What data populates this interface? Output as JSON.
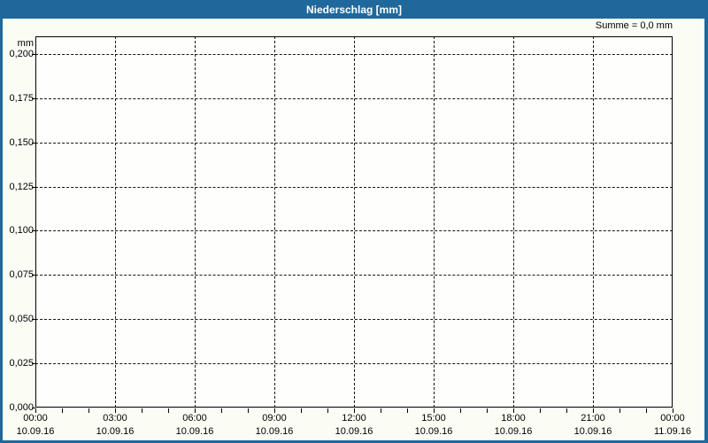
{
  "window": {
    "title": "Niederschlag [mm]"
  },
  "colors": {
    "titlebar_background": "#1e689c",
    "titlebar_text": "#ffffff",
    "window_border": "#1e689c",
    "page_background": "#fbfcf4",
    "plot_background": "#fefefc",
    "grid_color": "#161616",
    "axis_color": "#000000",
    "label_color": "#000000"
  },
  "chart_data": {
    "type": "bar",
    "title": "Niederschlag [mm]",
    "ylabel": "mm",
    "xlabel": "",
    "annotation": "Summe = 0,0 mm",
    "sum_mm": 0.0,
    "series": [],
    "values": [],
    "x": [],
    "note": "empty precipitation chart, no data plotted, total sum 0,0 mm",
    "grid": "dashed",
    "legend_position": "none",
    "ylim": [
      0,
      0.21
    ],
    "yticks": [
      {
        "value": 0.2,
        "label": "0,200"
      },
      {
        "value": 0.175,
        "label": "0,175"
      },
      {
        "value": 0.15,
        "label": "0,150"
      },
      {
        "value": 0.125,
        "label": "0,125"
      },
      {
        "value": 0.1,
        "label": "0,100"
      },
      {
        "value": 0.075,
        "label": "0,075"
      },
      {
        "value": 0.05,
        "label": "0,050"
      },
      {
        "value": 0.025,
        "label": "0,025"
      },
      {
        "value": 0.0,
        "label": "0,000"
      }
    ],
    "xticks": [
      {
        "time": "00:00",
        "date": "10.09.16"
      },
      {
        "time": "03:00",
        "date": "10.09.16"
      },
      {
        "time": "06:00",
        "date": "10.09.16"
      },
      {
        "time": "09:00",
        "date": "10.09.16"
      },
      {
        "time": "12:00",
        "date": "10.09.16"
      },
      {
        "time": "15:00",
        "date": "10.09.16"
      },
      {
        "time": "18:00",
        "date": "10.09.16"
      },
      {
        "time": "21:00",
        "date": "10.09.16"
      },
      {
        "time": "00:00",
        "date": "11.09.16"
      }
    ],
    "minor_ticks_per_major_interval": 3
  }
}
